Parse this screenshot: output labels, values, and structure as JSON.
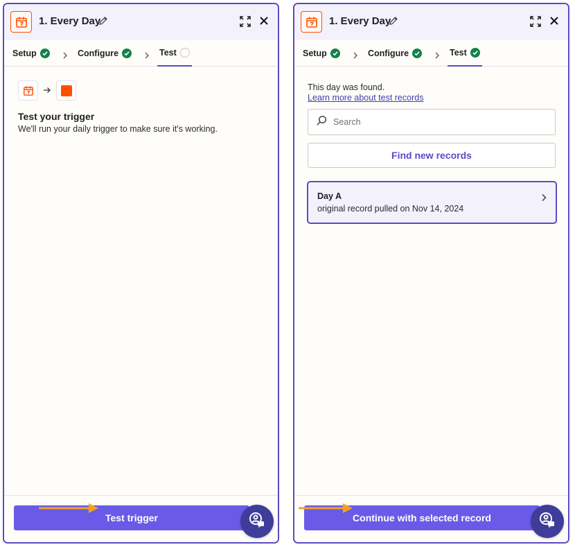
{
  "left": {
    "step_title": "1. Every Day",
    "tabs": [
      {
        "label": "Setup",
        "status": "complete"
      },
      {
        "label": "Configure",
        "status": "complete"
      },
      {
        "label": "Test",
        "status": "incomplete"
      }
    ],
    "heading": "Test your trigger",
    "subtext": "We'll run your daily trigger to make sure it's working.",
    "button_label": "Test trigger"
  },
  "right": {
    "step_title": "1. Every Day",
    "tabs": [
      {
        "label": "Setup",
        "status": "complete"
      },
      {
        "label": "Configure",
        "status": "complete"
      },
      {
        "label": "Test",
        "status": "complete"
      }
    ],
    "found_text": "This day was found.",
    "learn_link": "Learn more about test records",
    "search_placeholder": "Search",
    "find_button": "Find new records",
    "record": {
      "title": "Day A",
      "subtitle": "original record pulled on Nov 14, 2024"
    },
    "button_label": "Continue with selected record"
  },
  "colors": {
    "accent": "#695be8",
    "panel_border": "#5a4bc4",
    "brand_orange": "#ff4f00",
    "check_green": "#12824b",
    "annotation_arrow": "#f7a21b"
  },
  "icons": [
    "calendar-icon",
    "pencil-icon",
    "expand-icon",
    "close-icon",
    "check-icon",
    "chevron-right-icon",
    "arrow-right-icon",
    "search-icon",
    "help-chat-icon"
  ]
}
